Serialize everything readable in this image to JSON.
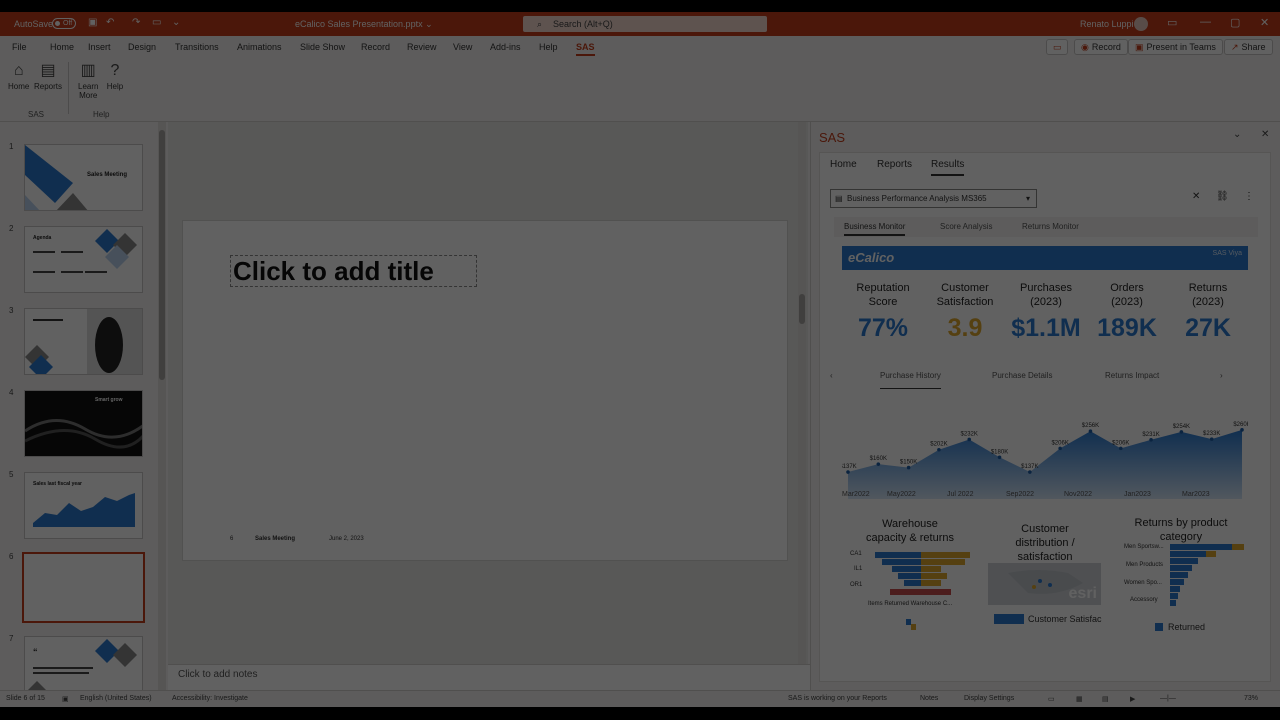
{
  "titlebar": {
    "autosave": "AutoSave",
    "toggle": "Off",
    "doc_title": "eCalico Sales Presentation.pptx ⌄",
    "search_placeholder": "Search (Alt+Q)",
    "user": "Renato Luppi"
  },
  "menu": {
    "tabs": [
      "File",
      "Home",
      "Insert",
      "Design",
      "Transitions",
      "Animations",
      "Slide Show",
      "Record",
      "Review",
      "View",
      "Add-ins",
      "Help",
      "SAS"
    ],
    "active": "SAS",
    "record_btn": "Record",
    "present_btn": "Present in Teams",
    "share_btn": "Share"
  },
  "ribbon": {
    "home": "Home",
    "reports": "Reports",
    "learn_more_1": "Learn",
    "learn_more_2": "More",
    "help": "Help",
    "group_sas": "SAS",
    "group_help": "Help"
  },
  "thumbnails": {
    "numbers": [
      "1",
      "2",
      "3",
      "4",
      "5",
      "6",
      "7"
    ],
    "slide1_title": "Sales Meeting",
    "slide2_title": "Agenda",
    "slide4_title": "Smart grow",
    "slide5_title": "Sales last fiscal year",
    "slide7_title": "“"
  },
  "slide": {
    "title_placeholder": "Click to add title",
    "footer_num": "6",
    "footer_name": "Sales Meeting",
    "footer_date": "June 2, 2023"
  },
  "notes": "Click to add notes",
  "status": {
    "slide": "Slide 6 of 15",
    "language": "English (United States)",
    "accessibility": "Accessibility: Investigate",
    "sas_working": "SAS is working on your Reports",
    "notes": "Notes",
    "display": "Display Settings",
    "zoom": "73%"
  },
  "sas_pane": {
    "title": "SAS",
    "tabs": [
      "Home",
      "Reports",
      "Results"
    ],
    "active_tab": "Results",
    "report_name": "Business Performance Analysis MS365",
    "report_tabs": [
      "Business Monitor",
      "Score Analysis",
      "Returns Monitor"
    ],
    "brand": "eCalico",
    "sas_viya": "SAS Viya",
    "kpis": [
      {
        "label1": "Reputation",
        "label2": "Score",
        "value": "77%",
        "color": "#2b7ad0"
      },
      {
        "label1": "Customer",
        "label2": "Satisfaction",
        "value": "3.9",
        "color": "#e0a92d"
      },
      {
        "label1": "Purchases",
        "label2": "(2023)",
        "value": "$1.1M",
        "color": "#2b7ad0"
      },
      {
        "label1": "Orders",
        "label2": "(2023)",
        "value": "189K",
        "color": "#2b7ad0"
      },
      {
        "label1": "Returns",
        "label2": "(2023)",
        "value": "27K",
        "color": "#2b7ad0"
      }
    ],
    "sub_tabs": [
      "Purchase History",
      "Purchase Details",
      "Returns Impact"
    ],
    "chart_data": {
      "type": "area",
      "x_ticks": [
        "Mar2022",
        "May2022",
        "Jul 2022",
        "Sep2022",
        "Nov2022",
        "Jan2023",
        "Mar2023"
      ],
      "values": [
        137,
        160,
        150,
        202,
        232,
        180,
        137,
        206,
        256,
        206,
        231,
        254,
        233,
        260
      ],
      "labels": [
        "$137K",
        "$160K",
        "$150K",
        "$202K",
        "$232K",
        "$180K",
        "$137K",
        "$206K",
        "$256K",
        "$206K",
        "$231K",
        "$254K",
        "$233K",
        "$260K"
      ],
      "colors": {
        "area_top": "#2b7ad0",
        "area_bottom": "#d6e6f7"
      }
    },
    "warehouse_title1": "Warehouse",
    "warehouse_title2": "capacity & returns",
    "warehouse_rows": [
      "CA1",
      "IL1",
      "OR1"
    ],
    "warehouse_axis": "Items Returned Warehouse C...",
    "customer_title1": "Customer",
    "customer_title2": "distribution /",
    "customer_title3": "satisfaction",
    "customer_legend": "Customer Satisfac",
    "esri": "esri",
    "returns_title1": "Returns by product",
    "returns_title2": "category",
    "returns_rows": [
      "Men Sportsw...",
      "Men Products",
      "Women Spo...",
      "Accessory"
    ],
    "returns_legend": "Returned"
  }
}
